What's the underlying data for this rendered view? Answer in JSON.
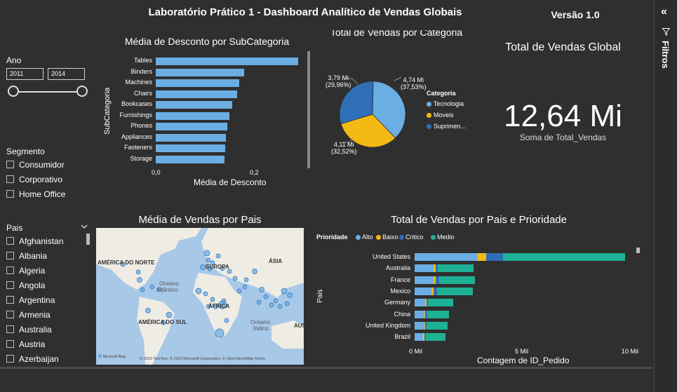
{
  "header": {
    "title": "Laboratório Prático 1 - Dashboard Analítico de Vendas Globais",
    "version": "Versão 1.0"
  },
  "filters_pane": {
    "collapse_icon": "double-chevron-left-icon",
    "filter_icon": "funnel-icon",
    "label": "Filtros"
  },
  "year_slicer": {
    "label": "Ano",
    "from": "2011",
    "to": "2014"
  },
  "segment_slicer": {
    "label": "Segmento",
    "items": [
      "Consumidor",
      "Corporativo",
      "Home Office"
    ]
  },
  "country_slicer": {
    "label": "Pais",
    "items": [
      "Afghanistan",
      "Albania",
      "Algeria",
      "Angola",
      "Argentina",
      "Armenia",
      "Australia",
      "Austria",
      "Azerbaijan"
    ]
  },
  "discount_chart": {
    "title": "Média de Desconto por SubCategoria",
    "ylabel": "SubCategoria",
    "xlabel": "Média de Desconto",
    "ticks": [
      "0,0",
      "0,2"
    ]
  },
  "pie_chart": {
    "title": "Total de Vendas por Categoria",
    "legend_title": "Categoria",
    "labels": [
      {
        "value": "4,74 Mi",
        "pct": "(37,53%)"
      },
      {
        "value": "4,11 Mi",
        "pct": "(32,52%)"
      },
      {
        "value": "3,79 Mi",
        "pct": "(29,96%)"
      }
    ]
  },
  "kpi": {
    "title": "Total de Vendas Global",
    "value": "12,64 Mi",
    "caption": "Soma de Total_Vendas"
  },
  "map_chart": {
    "title": "Média de Vendas por Pais",
    "labels": {
      "na": "AMÉRICA DO NORTE",
      "eu": "EUROPA",
      "asia": "ÁSIA",
      "atl1": "Oceano",
      "atl2": "Atlântico",
      "af": "ÁFRICA",
      "sa": "AMÉRICA DO SUL",
      "ind1": "Oceano",
      "ind2": "Índico",
      "aus": "AUSTR"
    },
    "attribution": "© 2023 TomTom, © 2023 Microsoft Corporation, © OpenStreetMap  Terms",
    "bing": "Microsoft Bing"
  },
  "priority_chart": {
    "title": "Total de Vendas por Pais e Prioridade",
    "legend_title": "Prioridade",
    "ylabel": "Pais",
    "xlabel": "Contagem de ID_Pedido",
    "ticks": [
      "0 Mil",
      "5 Mil",
      "10 Mil"
    ]
  },
  "chart_data": [
    {
      "type": "bar",
      "orientation": "horizontal",
      "title": "Média de Desconto por SubCategoria",
      "xlabel": "Média de Desconto",
      "ylabel": "SubCategoria",
      "categories": [
        "Tables",
        "Binders",
        "Machines",
        "Chairs",
        "Bookcases",
        "Furnishings",
        "Phones",
        "Appliances",
        "Fasteners",
        "Storage"
      ],
      "values": [
        0.29,
        0.18,
        0.17,
        0.165,
        0.155,
        0.15,
        0.145,
        0.143,
        0.142,
        0.14
      ],
      "xlim": [
        0,
        0.3
      ]
    },
    {
      "type": "pie",
      "title": "Total de Vendas por Categoria",
      "categories": [
        "Tecnologia",
        "Moveis",
        "Suprimen..."
      ],
      "values": [
        4.74,
        4.11,
        3.79
      ],
      "colors": [
        "#6aaee3",
        "#f5b913",
        "#2e6fb7"
      ],
      "legend": "right"
    },
    {
      "type": "bar",
      "orientation": "horizontal",
      "stacked": true,
      "title": "Total de Vendas por Pais e Prioridade",
      "xlabel": "Contagem de ID_Pedido",
      "ylabel": "Pais",
      "categories": [
        "United States",
        "Australia",
        "France",
        "Mexico",
        "Germany",
        "China",
        "United Kingdom",
        "Brazil"
      ],
      "series": [
        {
          "name": "Alto",
          "color": "#6aaee3",
          "values": [
            3000,
            900,
            900,
            800,
            500,
            450,
            450,
            400
          ]
        },
        {
          "name": "Baixo",
          "color": "#f5b913",
          "values": [
            400,
            100,
            100,
            100,
            60,
            60,
            50,
            50
          ]
        },
        {
          "name": "Critico",
          "color": "#2e6fb7",
          "values": [
            800,
            100,
            150,
            150,
            80,
            80,
            80,
            70
          ]
        },
        {
          "name": "Medio",
          "color": "#1fb195",
          "values": [
            5800,
            1700,
            1700,
            1700,
            1200,
            1050,
            1000,
            950
          ]
        }
      ],
      "xlim": [
        0,
        10000
      ],
      "legend": "top-left"
    }
  ]
}
